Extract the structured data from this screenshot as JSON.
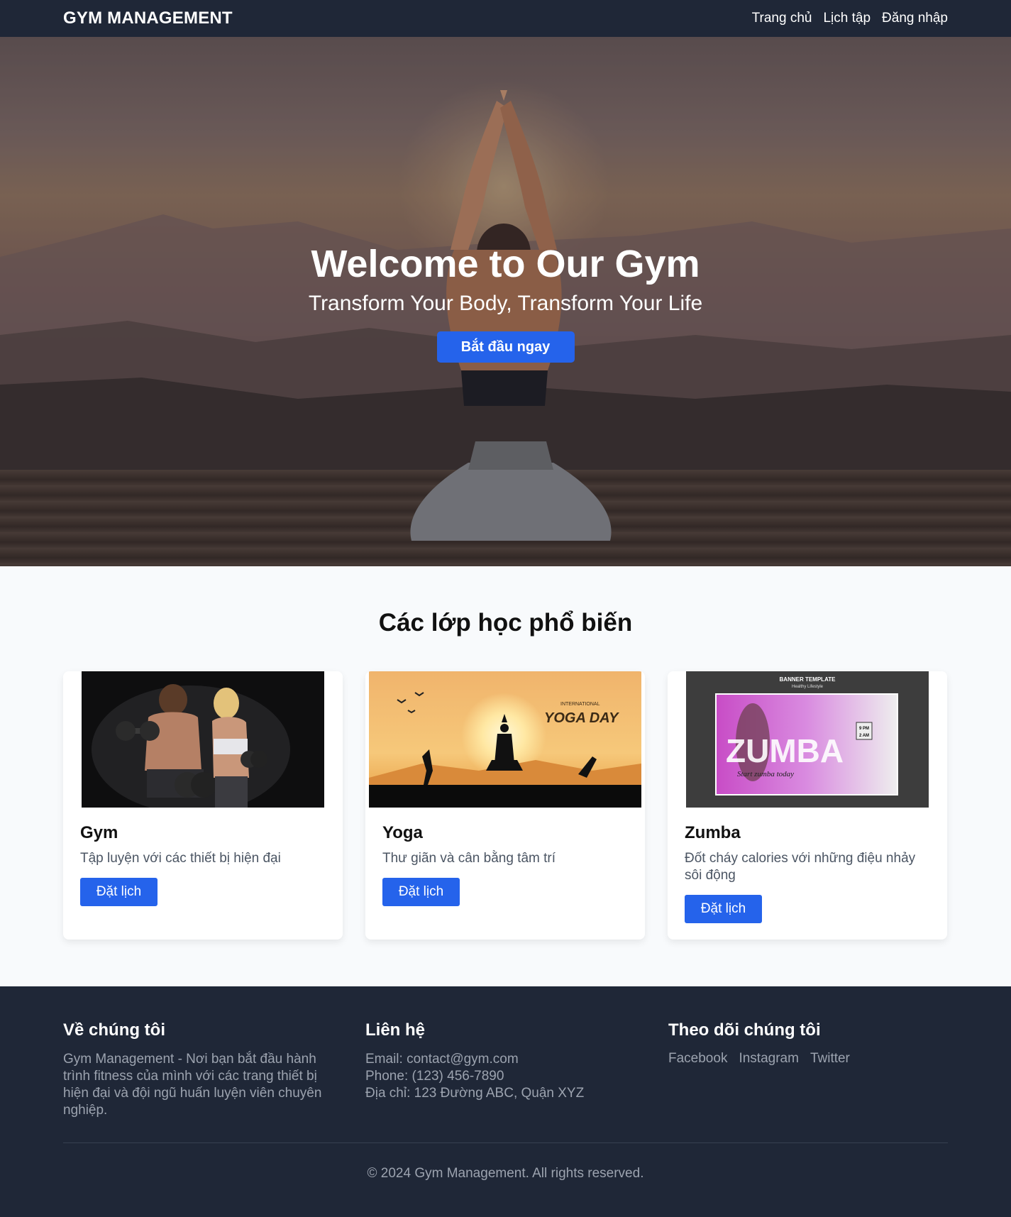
{
  "nav": {
    "brand": "GYM MANAGEMENT",
    "links": [
      "Trang chủ",
      "Lịch tập",
      "Đăng nhập"
    ]
  },
  "hero": {
    "title": "Welcome to Our Gym",
    "subtitle": "Transform Your Body, Transform Your Life",
    "cta": "Bắt đầu ngay"
  },
  "classes": {
    "title": "Các lớp học phổ biến",
    "items": [
      {
        "name": "Gym",
        "description": "Tập luyện với các thiết bị hiện đại",
        "button": "Đặt lịch"
      },
      {
        "name": "Yoga",
        "description": "Thư giãn và cân bằng tâm trí",
        "button": "Đặt lịch",
        "image_text": [
          "INTERNATIONAL",
          "YOGA DAY"
        ]
      },
      {
        "name": "Zumba",
        "description": "Đốt cháy calories với những điệu nhảy sôi động",
        "button": "Đặt lịch",
        "image_text": [
          "BANNER TEMPLATE",
          "Healthy Lifestyle",
          "ZUMBA",
          "Start zumba today",
          "9 PM",
          "2 AM"
        ]
      }
    ]
  },
  "footer": {
    "about": {
      "title": "Về chúng tôi",
      "text": "Gym Management - Nơi bạn bắt đầu hành trình fitness của mình với các trang thiết bị hiện đại và đội ngũ huấn luyện viên chuyên nghiệp."
    },
    "contact": {
      "title": "Liên hệ",
      "email": "Email: contact@gym.com",
      "phone": "Phone: (123) 456-7890",
      "address": "Địa chỉ: 123 Đường ABC, Quận XYZ"
    },
    "follow": {
      "title": "Theo dõi chúng tôi",
      "links": [
        "Facebook",
        "Instagram",
        "Twitter"
      ]
    },
    "copyright": "© 2024 Gym Management. All rights reserved."
  },
  "colors": {
    "nav_bg": "#1f2737",
    "accent": "#2563eb",
    "muted": "#9ca3af"
  }
}
